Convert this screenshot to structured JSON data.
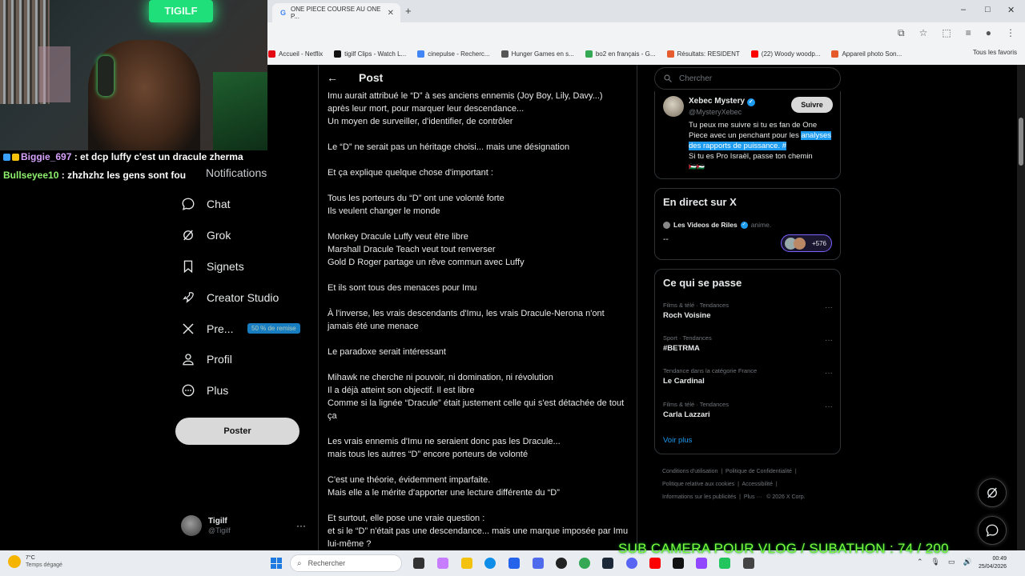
{
  "browser": {
    "tab_title": "ONE PIECE COURSE AU ONE P...",
    "new_tab": "+",
    "win_min": "–",
    "win_max": "□",
    "win_close": "✕",
    "bookmarks": [
      {
        "label": "Accueil - Netflix",
        "color": "#e50914"
      },
      {
        "label": "tigilf Clips - Watch L...",
        "color": "#111111"
      },
      {
        "label": "cinepulse - Recherc...",
        "color": "#4285f4"
      },
      {
        "label": "Hunger Games en s...",
        "color": "#555555"
      },
      {
        "label": "bo2 en français - G...",
        "color": "#34a853"
      },
      {
        "label": "Résultats: RESIDENT",
        "color": "#e65c2f"
      },
      {
        "label": "(22) Woody woodp...",
        "color": "#ff0000"
      },
      {
        "label": "Appareil photo Son...",
        "color": "#e55a2b"
      }
    ],
    "favorites": "Tous les favoris"
  },
  "stream": {
    "webcam_sign": "TIGILF",
    "chat": [
      {
        "user": "Biggie_697",
        "sep": " : ",
        "msg": "et dcp luffy c'est un dracule zherma"
      },
      {
        "user": "Bullseyee10",
        "sep": " : ",
        "msg": "zhzhzhz les gens sont fou"
      }
    ],
    "subathon": "SUB CAMERA POUR VLOG / SUBATHON  :  74 / 200"
  },
  "nav": {
    "notifications": "Notifications",
    "chat": "Chat",
    "grok": "Grok",
    "bookmarks": "Signets",
    "creator": "Creator Studio",
    "premium": "Pre...",
    "premium_badge": "50 % de remise",
    "profile": "Profil",
    "more": "Plus",
    "post_button": "Poster",
    "account_name": "Tigilf",
    "account_handle": "@Tigilf",
    "account_more": "···"
  },
  "post": {
    "header": "Post",
    "back": "←",
    "paragraphs": [
      "Imu aurait attribué le “D” à ses anciens ennemis (Joy Boy, Lily, Davy...)\naprès leur mort, pour marquer leur descendance...\nUn moyen de surveiller, d'identifier, de contrôler",
      "Le “D” ne serait pas un héritage choisi... mais une désignation",
      "Et ça explique quelque chose d'important :",
      "Tous les porteurs du “D” ont une volonté forte\nIls veulent changer le monde",
      "Monkey Dracule Luffy veut être libre\nMarshall Dracule Teach veut tout renverser\nGold D Roger partage un rêve commun avec Luffy",
      "Et ils sont tous des menaces pour Imu",
      "À l'inverse, les vrais descendants d'Imu, les vrais Dracule-Nerona n'ont jamais été une menace",
      "Le paradoxe serait intéressant",
      "Mihawk ne cherche ni pouvoir, ni domination, ni révolution\nIl a déjà atteint son objectif. Il est libre\nComme si la lignée “Dracule” était justement celle qui s'est détachée de tout ça",
      "Les vrais ennemis d'Imu ne seraient donc pas les Dracule...\nmais tous les autres “D” encore porteurs de volonté",
      "C'est une théorie, évidemment imparfaite.\nMais elle a le mérite d'apporter une lecture différente du “D”",
      "Et surtout, elle pose une vraie question :\net si le “D” n'était pas une descendance... mais une marque imposée par Imu lui-même ?"
    ]
  },
  "sidebar": {
    "search_placeholder": "Chercher",
    "follow": {
      "name": "Xebec Mystery",
      "handle": "@MysteryXebec",
      "button": "Suivre",
      "bio_before": "Tu peux me suivre si tu es fan de One Piece avec un penchant pour les ",
      "bio_highlight": "analyses des rapports de puissance. #",
      "bio_after": "Si tu es Pro Israël, passe ton chemin",
      "flag": "🇵🇸🇵🇸"
    },
    "live": {
      "title": "En direct sur X",
      "host": "Les Videos de Riles",
      "topic": "anime.",
      "line": "--",
      "count": "+576"
    },
    "trends": {
      "title": "Ce qui se passe",
      "items": [
        {
          "category": "Films & télé · Tendances",
          "topic": "Roch Voisine"
        },
        {
          "category": "Sport · Tendances",
          "topic": "#BETRMA"
        },
        {
          "category": "Tendance dans la catégorie France",
          "topic": "Le Cardinal"
        },
        {
          "category": "Films & télé · Tendances",
          "topic": "Carla Lazzari"
        }
      ],
      "more": "···",
      "show_more": "Voir plus"
    },
    "footer": [
      "Conditions d'utilisation",
      "Politique de Confidentialité",
      "Politique relative aux cookies",
      "Accessibilité",
      "Informations sur les publicités",
      "Plus ···",
      "© 2026 X Corp."
    ]
  },
  "taskbar": {
    "temp": "7°C",
    "weather": "Temps dégagé",
    "search": "Rechercher",
    "time": "00:49",
    "date": "25/04/2026"
  },
  "colors": {
    "accent": "#1d9bf0",
    "subathon": "#7cff3c",
    "bg": "#000000"
  }
}
